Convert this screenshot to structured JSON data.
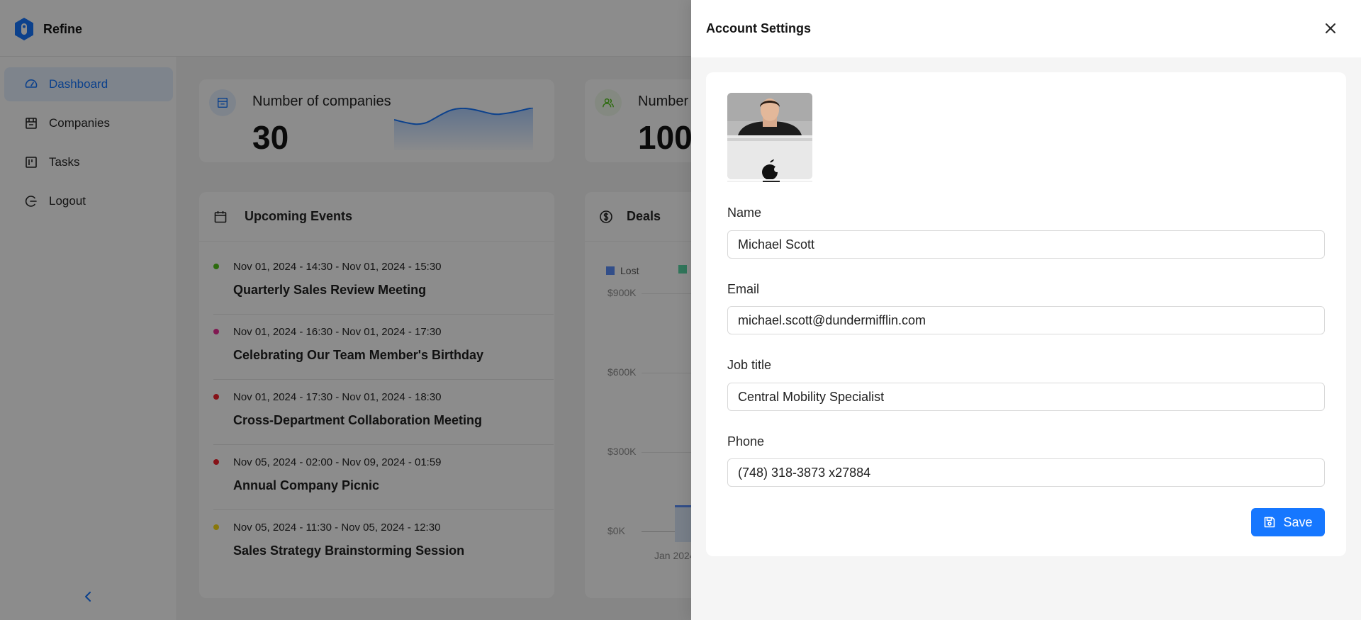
{
  "app": {
    "name": "Refine",
    "logo_icon": "refine-logo-icon",
    "accent_color": "#1677ff"
  },
  "sidebar": {
    "items": [
      {
        "label": "Dashboard",
        "icon": "dashboard-icon",
        "active": true
      },
      {
        "label": "Companies",
        "icon": "shop-icon",
        "active": false
      },
      {
        "label": "Tasks",
        "icon": "kanban-icon",
        "active": false
      },
      {
        "label": "Logout",
        "icon": "logout-icon",
        "active": false
      }
    ],
    "collapse_icon": "chevron-left-icon"
  },
  "kpis": [
    {
      "title": "Number of companies",
      "value": "30",
      "icon": "shop-icon",
      "icon_color": "#1677ff",
      "icon_bg": "#e6f0ff"
    },
    {
      "title": "Number",
      "value": "100",
      "icon": "team-icon",
      "icon_color": "#52c41a",
      "icon_bg": "#f0f9eb"
    }
  ],
  "upcoming_events": {
    "title": "Upcoming Events",
    "icon": "calendar-icon",
    "items": [
      {
        "time": "Nov 01, 2024 - 14:30 - Nov 01, 2024 - 15:30",
        "title": "Quarterly Sales Review Meeting",
        "color": "#52c41a"
      },
      {
        "time": "Nov 01, 2024 - 16:30 - Nov 01, 2024 - 17:30",
        "title": "Celebrating Our Team Member's Birthday",
        "color": "#eb2f96"
      },
      {
        "time": "Nov 01, 2024 - 17:30 - Nov 01, 2024 - 18:30",
        "title": "Cross-Department Collaboration Meeting",
        "color": "#f5222d"
      },
      {
        "time": "Nov 05, 2024 - 02:00 - Nov 09, 2024 - 01:59",
        "title": "Annual Company Picnic",
        "color": "#f5222d"
      },
      {
        "time": "Nov 05, 2024 - 11:30 - Nov 05, 2024 - 12:30",
        "title": "Sales Strategy Brainstorming Session",
        "color": "#fadb14"
      }
    ]
  },
  "deals": {
    "title": "Deals",
    "icon": "dollar-icon",
    "legend": [
      {
        "label": "Lost",
        "color": "#5b8ff9"
      },
      {
        "label": "",
        "color": "#5ad8a6"
      }
    ]
  },
  "chart_data": {
    "type": "area",
    "title": "Deals",
    "xlabel": "",
    "ylabel": "",
    "categories": [
      "Jan 2024"
    ],
    "y_ticks": [
      "$900K",
      "$600K",
      "$300K",
      "$0K"
    ],
    "ylim": [
      0,
      900000
    ],
    "legend": [
      "Lost"
    ],
    "grid": true,
    "legend_position": "top-left"
  },
  "drawer": {
    "title": "Account Settings",
    "close_icon": "close-icon",
    "avatar_icon": "avatar-photo",
    "fields": [
      {
        "label": "Name",
        "value": "Michael Scott"
      },
      {
        "label": "Email",
        "value": "michael.scott@dundermifflin.com"
      },
      {
        "label": "Job title",
        "value": "Central Mobility Specialist"
      },
      {
        "label": "Phone",
        "value": "(748) 318-3873 x27884"
      }
    ],
    "save_label": "Save",
    "save_icon": "save-icon"
  }
}
